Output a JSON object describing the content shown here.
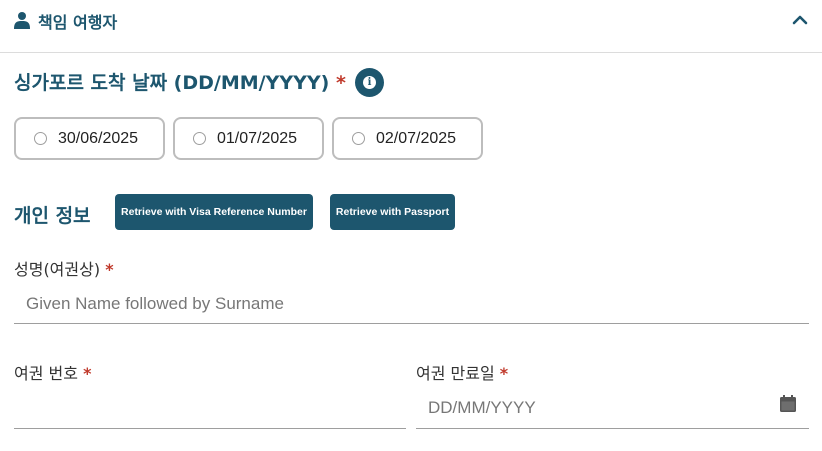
{
  "header": {
    "title": "책임 여행자"
  },
  "arrival": {
    "label": "싱가포르 도착 날짜 (DD/MM/YYYY)",
    "required_mark": "*",
    "info_glyph": "i",
    "options": [
      {
        "label": "30/06/2025",
        "selected": false
      },
      {
        "label": "01/07/2025",
        "selected": false
      },
      {
        "label": "02/07/2025",
        "selected": false
      }
    ]
  },
  "personal": {
    "label": "개인 정보",
    "retrieve_visa_button": "Retrieve with Visa Reference Number",
    "retrieve_passport_button": "Retrieve with Passport"
  },
  "fields": {
    "name": {
      "label": "성명(여권상)",
      "required_mark": "*",
      "value": "",
      "placeholder": "Given Name followed by Surname"
    },
    "passport_no": {
      "label": "여권 번호",
      "required_mark": "*",
      "value": "",
      "placeholder": ""
    },
    "passport_expiry": {
      "label": "여권 만료일",
      "required_mark": "*",
      "value": "",
      "placeholder": "DD/MM/YYYY"
    }
  },
  "icons": {
    "header": "person-icon",
    "collapse": "chevron-up-icon",
    "info": "info-icon",
    "calendar": "calendar-icon"
  },
  "colors": {
    "brand": "#1d566e",
    "required": "#c0392b",
    "border": "#bdbdbd"
  }
}
